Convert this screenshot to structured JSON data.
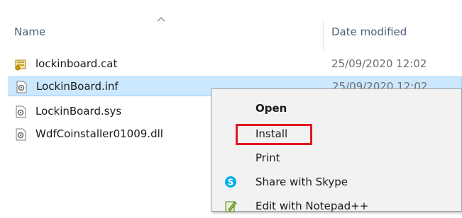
{
  "columns": {
    "name": "Name",
    "date_modified": "Date modified"
  },
  "files": [
    {
      "name": "lockinboard.cat",
      "date": "25/09/2020 12:02",
      "icon": "security-catalog-icon",
      "selected": false
    },
    {
      "name": "LockinBoard.inf",
      "date": "25/09/2020 12:02",
      "icon": "setup-information-icon",
      "selected": true
    },
    {
      "name": "LockinBoard.sys",
      "date": "",
      "icon": "system-file-icon",
      "selected": false
    },
    {
      "name": "WdfCoinstaller01009.dll",
      "date": "",
      "icon": "dll-file-icon",
      "selected": false
    }
  ],
  "context_menu": {
    "items": [
      {
        "label": "Open",
        "bold": true,
        "icon": ""
      },
      {
        "label": "Install",
        "bold": false,
        "icon": "",
        "highlighted": true
      },
      {
        "label": "Print",
        "bold": false,
        "icon": ""
      },
      {
        "label": "Share with Skype",
        "bold": false,
        "icon": "skype-icon"
      },
      {
        "label": "Edit with Notepad++",
        "bold": false,
        "icon": "notepad-plus-plus-icon"
      }
    ]
  },
  "colors": {
    "selection_bg": "#cce8ff",
    "selection_border": "#99d1ff",
    "highlight_box": "#e2181f",
    "skype": "#00aff0"
  }
}
